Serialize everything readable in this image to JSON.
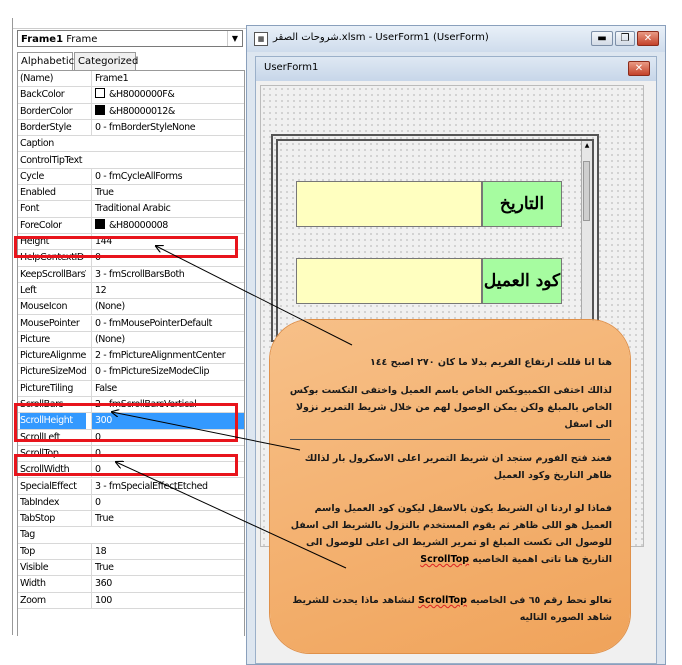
{
  "properties": {
    "object_name": "Frame1",
    "object_type": "Frame",
    "tabs": [
      "Alphabetic",
      "Categorized"
    ],
    "rows": [
      {
        "name": "(Name)",
        "value": "Frame1"
      },
      {
        "name": "BackColor",
        "value": "&H8000000F&",
        "swatch": "#ffffff"
      },
      {
        "name": "BorderColor",
        "value": "&H80000012&",
        "swatch": "#000000"
      },
      {
        "name": "BorderStyle",
        "value": "0 - fmBorderStyleNone"
      },
      {
        "name": "Caption",
        "value": ""
      },
      {
        "name": "ControlTipText",
        "value": ""
      },
      {
        "name": "Cycle",
        "value": "0 - fmCycleAllForms"
      },
      {
        "name": "Enabled",
        "value": "True"
      },
      {
        "name": "Font",
        "value": "Traditional Arabic"
      },
      {
        "name": "ForeColor",
        "value": "&H80000008",
        "swatch": "#000000"
      },
      {
        "name": "Height",
        "value": "144"
      },
      {
        "name": "HelpContextID",
        "value": "0"
      },
      {
        "name": "KeepScrollBarsVisible",
        "value": "3 - fmScrollBarsBoth"
      },
      {
        "name": "Left",
        "value": "12"
      },
      {
        "name": "MouseIcon",
        "value": "(None)"
      },
      {
        "name": "MousePointer",
        "value": "0 - fmMousePointerDefault"
      },
      {
        "name": "Picture",
        "value": "(None)"
      },
      {
        "name": "PictureAlignment",
        "value": "2 - fmPictureAlignmentCenter"
      },
      {
        "name": "PictureSizeMode",
        "value": "0 - fmPictureSizeModeClip"
      },
      {
        "name": "PictureTiling",
        "value": "False"
      },
      {
        "name": "ScrollBars",
        "value": "2 - fmScrollBarsVertical"
      },
      {
        "name": "ScrollHeight",
        "value": "300",
        "selected": true
      },
      {
        "name": "ScrollLeft",
        "value": "0"
      },
      {
        "name": "ScrollTop",
        "value": "0"
      },
      {
        "name": "ScrollWidth",
        "value": "0"
      },
      {
        "name": "SpecialEffect",
        "value": "3 - fmSpecialEffectEtched"
      },
      {
        "name": "TabIndex",
        "value": "0"
      },
      {
        "name": "TabStop",
        "value": "True"
      },
      {
        "name": "Tag",
        "value": ""
      },
      {
        "name": "Top",
        "value": "18"
      },
      {
        "name": "Visible",
        "value": "True"
      },
      {
        "name": "Width",
        "value": "360"
      },
      {
        "name": "Zoom",
        "value": "100"
      }
    ]
  },
  "window": {
    "title": "شروحات الصقر.xlsm - UserForm1 (UserForm)",
    "minimize": "▬",
    "restore": "❐",
    "close": "✕"
  },
  "userform": {
    "title": "UserForm1",
    "close": "✕",
    "label_date": "التاريخ",
    "label_customer": "كود العميل"
  },
  "callout": {
    "p1": "هنا انا قللت ارتفاع الفريم بدلا ما كان ٢٧٠ اصبح ١٤٤",
    "p2": "لذالك اختفى الكمبيوبكس الخاص باسم العميل واختفى التكست بوكس الخاص بالمبلغ ولكن يمكن الوصول لهم من خلال شريط التمرير نزولا الى اسفل",
    "p3": "فعند فتح الفورم ستجد ان شريط التمرير اعلى الاسكرول بار لذالك ظاهر التاريخ وكود العميل",
    "p4": "فماذا لو اردنا ان الشريط يكون بالاسفل ليكون كود العميل واسم العميل هو اللى ظاهر ثم يقوم المستخدم بالنزول بالشريط الى اسفل للوصول الى تكست المبلغ او تمرير الشريط الى اعلى للوصول الى التاريخ  هنا تاتى اهمية الخاصيه",
    "p4_keyword": "ScrollTop",
    "p5_a": "تعالو نحط رقم ٦٥ فى الخاصيه",
    "p5_keyword": "ScrollTop",
    "p5_b": "لنشاهد ماذا يحدث للشريط شاهد الصوره التاليه"
  },
  "colors": {
    "highlight": "#e8141c",
    "callout": "#f0a35a",
    "label_bg": "#a6fca0",
    "textbox_bg": "#ffffc0",
    "selection": "#3399ff"
  }
}
